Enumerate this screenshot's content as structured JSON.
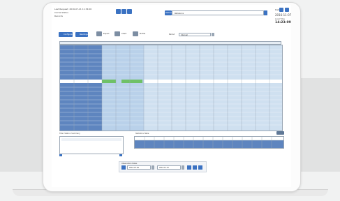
{
  "header": {
    "last_request": "Last Request: 2016-07-21 11:34:06",
    "cache_status": "Cache Status",
    "records": "Records",
    "station_label": "Station",
    "station_value": "Reference",
    "date_label": "Date",
    "date_value": "2016-11-07",
    "time_label": "Local Time",
    "time_value": "14:23:09"
  },
  "toolbar": {
    "buttons": [
      "Configure",
      "Readings",
      "Export",
      "Chart",
      "Profile"
    ]
  },
  "filter": {
    "label": "Period",
    "value": "Interval"
  },
  "panels": {
    "left_title": "Filter Station Summary",
    "right_title": "Statistics Table"
  },
  "footer": {
    "title": "Observation Dates",
    "date_from": "2016-07-09",
    "date_to": "2016-11-07"
  },
  "colors": {
    "accent": "#3b72c2",
    "grid_fill": "#cfe0f0",
    "highlight": "#6fc167",
    "panel_border": "#9aa7b5"
  }
}
